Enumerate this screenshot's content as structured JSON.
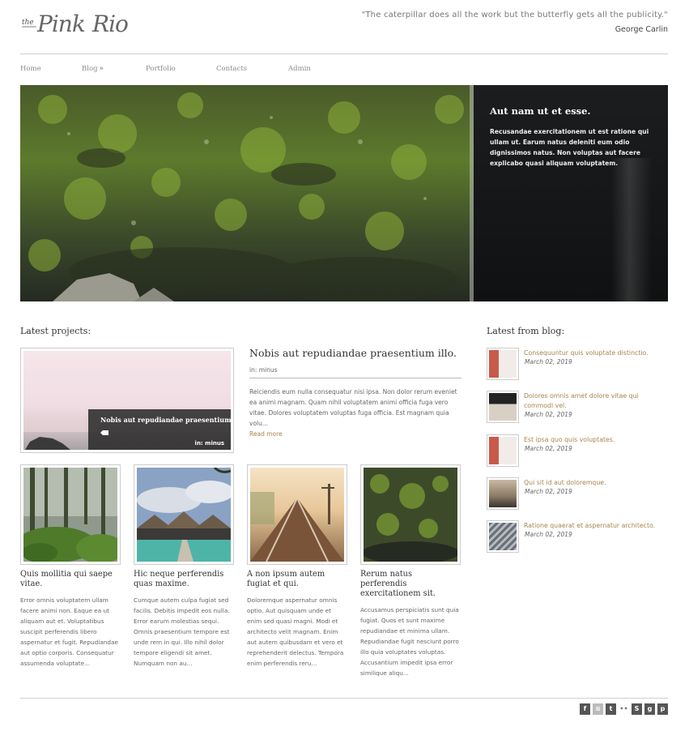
{
  "header": {
    "logo_alt": "the Pink Rio",
    "quote_text": "\"The caterpillar does all the work but the butterfly gets all the publicity.\"",
    "quote_author": "George Carlin"
  },
  "nav": {
    "items": [
      {
        "label": "Home"
      },
      {
        "label": "Blog",
        "submenu_indicator": "»"
      },
      {
        "label": "Portfolio"
      },
      {
        "label": "Contacts"
      },
      {
        "label": "Admin"
      }
    ]
  },
  "slider": {
    "title": "Aut nam ut et esse.",
    "text": "Recusandae exercitationem ut est ratione qui ullam ut. Earum natus deleniti eum odio dignissimos natus. Non voluptas aut facere explicabo quasi aliquam voluptatem."
  },
  "projects": {
    "section_title": "Latest projects:",
    "featured": {
      "overlay_title": "Nobis aut repudiandae praesentium illo.",
      "overlay_category": "in: minus",
      "title": "Nobis aut repudiandae praesentium illo.",
      "meta": "in: minus",
      "excerpt": "Reiciendis eum nulla consequatur nisi ipsa. Non dolor rerum eveniet ea animi magnam. Quam nihil voluptatem animi officia fuga vero vitae. Dolores voluptatem voluptas fuga officia. Est magnam quia volu...",
      "read_more": "Read more"
    },
    "items": [
      {
        "title": "Quis mollitia qui saepe vitae.",
        "excerpt": "Error omnis voluptatem ullam facere animi non. Eaque ea ut aliquam aut et. Voluptatibus suscipit perferendis libero aspernatur et fugit. Repudiandae aut optio corporis. Consequatur assumenda voluptate...",
        "image": "forest"
      },
      {
        "title": "Hic neque perferendis quas maxime.",
        "excerpt": "Cumque autem culpa fugiat sed facilis. Debitis impedit eos nulla. Error earum molestias sequi. Omnis praesentium tempore est unde rem in qui. Illo nihil dolor tempore eligendi sit amet. Numquam non au...",
        "image": "huts"
      },
      {
        "title": "A non ipsum autem fugiat et qui.",
        "excerpt": "Doloremque aspernatur omnis optio. Aut quisquam unde et enim sed quasi magni. Modi et architecto velit magnam. Enim aut autem quibusdam et vero et reprehenderit delectus. Tempora enim perferendis reru...",
        "image": "railway"
      },
      {
        "title": "Rerum natus perferendis exercitationem sit.",
        "excerpt": "Accusamus perspiciatis sunt quia fugiat. Quos et sunt maxime repudiandae et minima ullam. Repudiandae fugit nesciunt porro illo quia voluptates voluptas. Accusantium impedit ipsa error similique aliqu...",
        "image": "moss"
      }
    ]
  },
  "blog": {
    "section_title": "Latest from blog:",
    "posts": [
      {
        "title": "Consequuntur quis voluptate distinctio.",
        "date": "March 02, 2019"
      },
      {
        "title": "Dolores omnis amet dolore vitae qui commodi vel.",
        "date": "March 02, 2019"
      },
      {
        "title": "Est ipsa quo quis voluptates.",
        "date": "March 02, 2019"
      },
      {
        "title": "Qui sit id aut doloremque.",
        "date": "March 02, 2019"
      },
      {
        "title": "Ratione quaerat et aspernatur architecto.",
        "date": "March 02, 2019"
      }
    ]
  },
  "footer": {
    "social_icons": [
      {
        "name": "facebook-icon",
        "glyph": "f"
      },
      {
        "name": "rss-icon",
        "glyph": "≋"
      },
      {
        "name": "twitter-icon",
        "glyph": "t"
      },
      {
        "name": "flickr-icon",
        "glyph": "••"
      },
      {
        "name": "skype-icon",
        "glyph": "S"
      },
      {
        "name": "google-plus-icon",
        "glyph": "g"
      },
      {
        "name": "pinterest-icon",
        "glyph": "p"
      }
    ]
  },
  "colors": {
    "link_accent": "#a8844e",
    "caption_bg": "#141516",
    "text_main": "#333333"
  }
}
